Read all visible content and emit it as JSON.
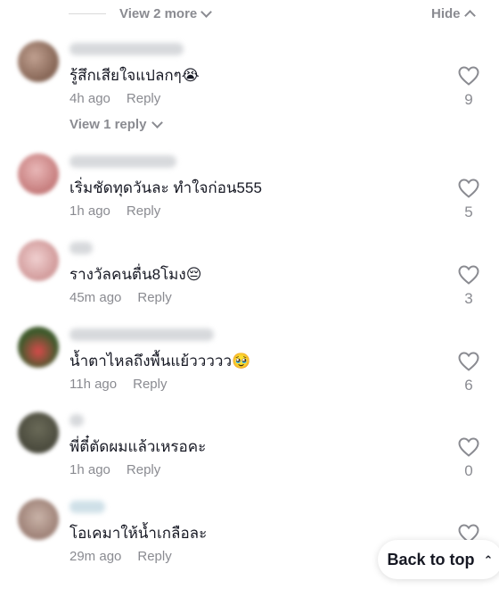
{
  "top": {
    "view_more": "View 2 more",
    "hide": "Hide"
  },
  "view_reply": "View 1 reply",
  "back_to_top": "Back to top",
  "comments": [
    {
      "text": "รู้สึกเสียใจแปลกๆ😭",
      "time": "4h ago",
      "reply": "Reply",
      "likes": "9"
    },
    {
      "text": "เริ่มชัดทุดวันละ ทำใจก่อน555",
      "time": "1h ago",
      "reply": "Reply",
      "likes": "5"
    },
    {
      "text": "รางวัลคนตื่น8โมง😔",
      "time": "45m ago",
      "reply": "Reply",
      "likes": "3"
    },
    {
      "text": "น้ำตาไหลถึงพื้นแย้ววววว🥹",
      "time": "11h ago",
      "reply": "Reply",
      "likes": "6"
    },
    {
      "text": "พี่ตี๋ตัดผมแล้วเหรอคะ",
      "time": "1h ago",
      "reply": "Reply",
      "likes": "0"
    },
    {
      "text": "โอเคมาให้น้ำเกลือละ",
      "time": "29m ago",
      "reply": "Reply",
      "likes": ""
    }
  ]
}
